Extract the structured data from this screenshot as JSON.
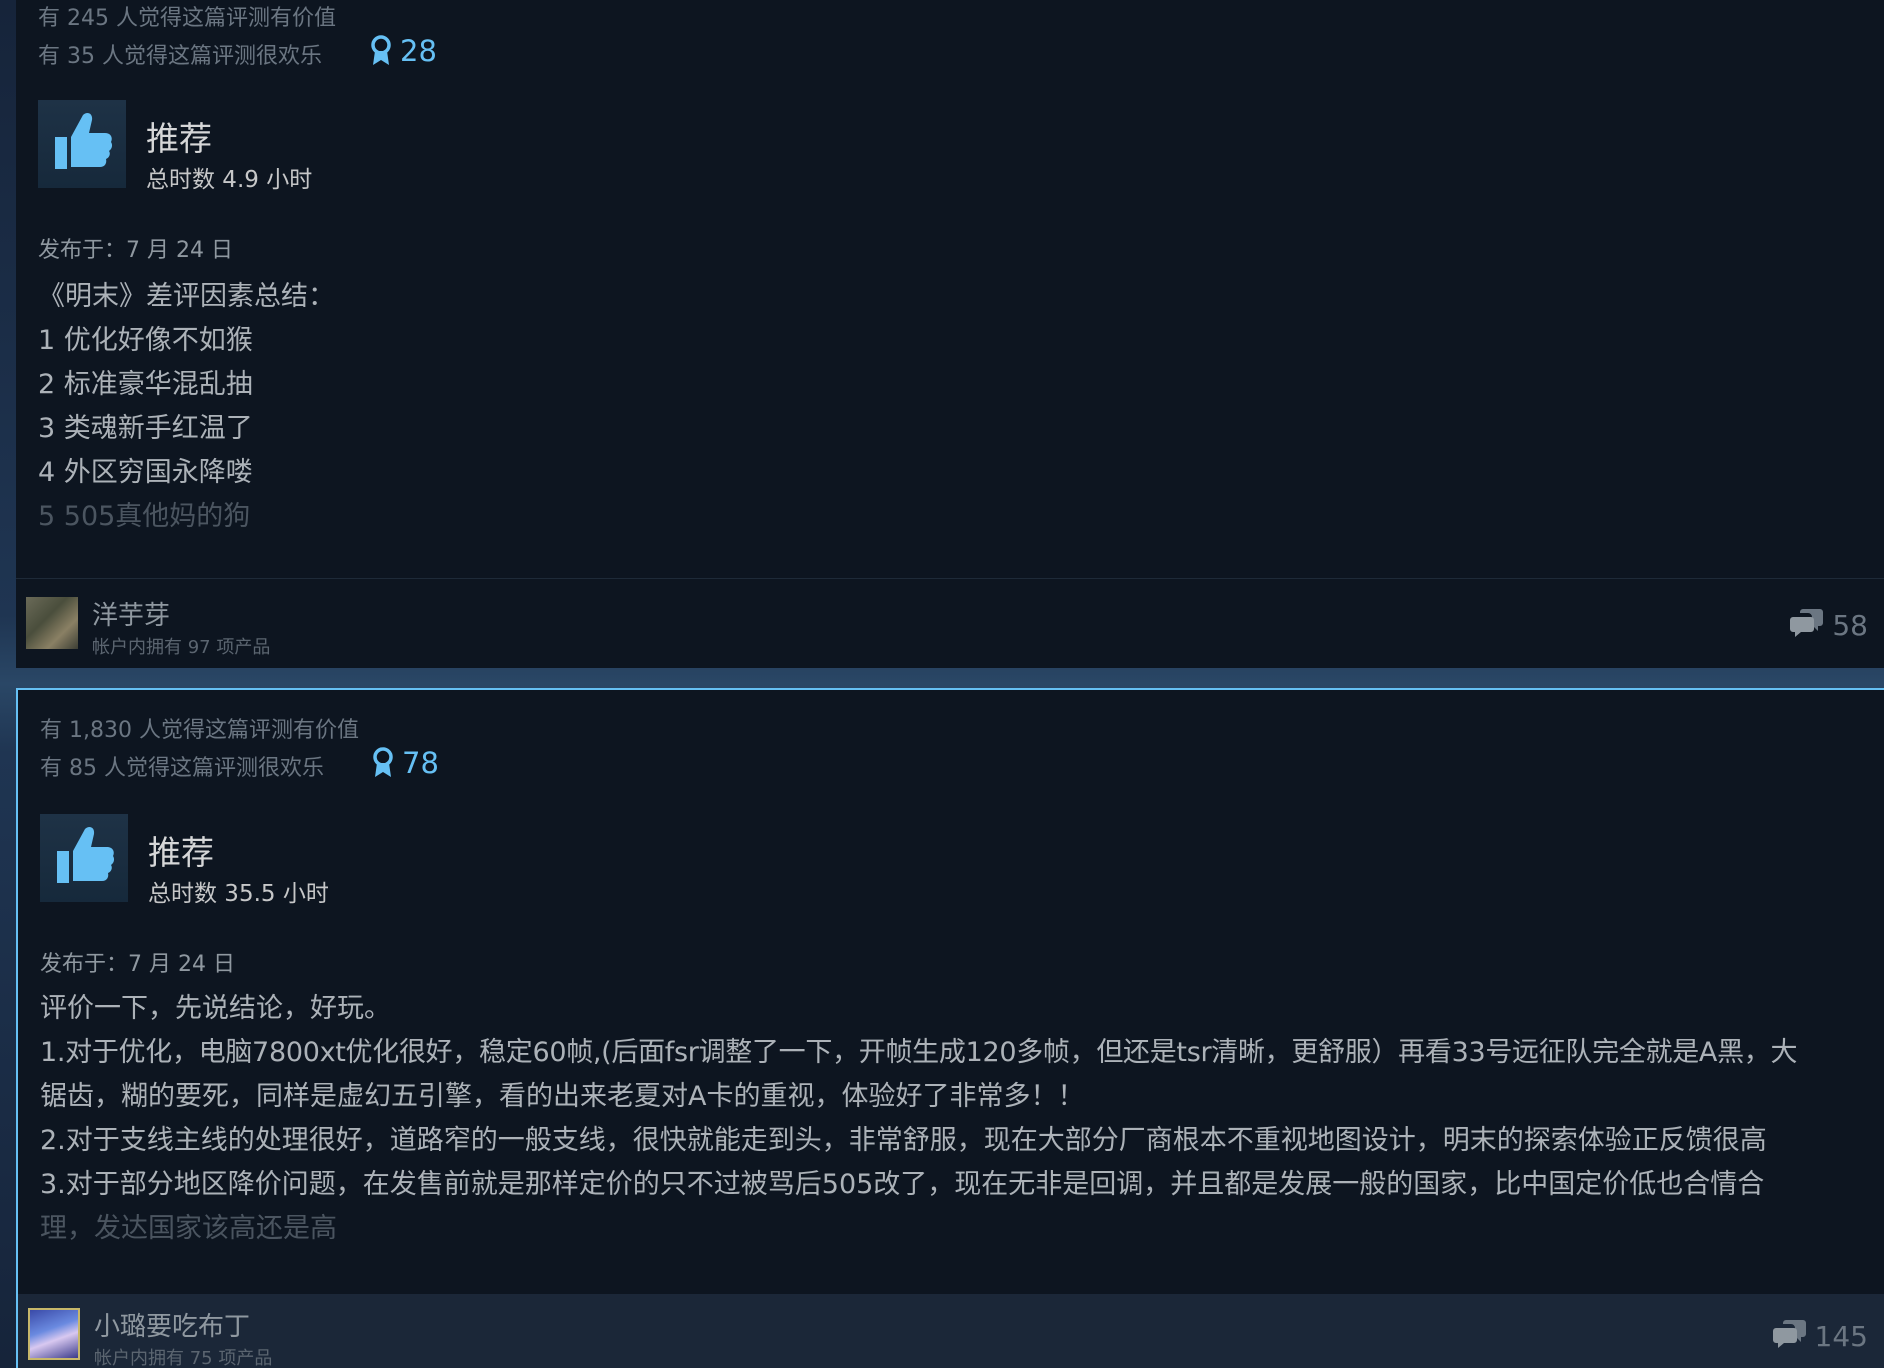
{
  "reviews": [
    {
      "helpful_text": "有 245 人觉得这篇评测有价值",
      "funny_text": "有 35 人觉得这篇评测很欢乐",
      "award_count": "28",
      "recommendation": "推荐",
      "hours": "总时数 4.9 小时",
      "posted": "发布于：7 月 24 日",
      "body": [
        "《明末》差评因素总结：",
        "1 优化好像不如猴",
        "2 标准豪华混乱抽",
        "3 类魂新手红温了",
        "4 外区穷国永降喽",
        "5 505真他妈的狗"
      ],
      "username": "洋芋芽",
      "products": "帐户内拥有 97 项产品",
      "comment_count": "58"
    },
    {
      "helpful_text": "有 1,830 人觉得这篇评测有价值",
      "funny_text": "有 85 人觉得这篇评测很欢乐",
      "award_count": "78",
      "recommendation": "推荐",
      "hours": "总时数 35.5 小时",
      "posted": "发布于：7 月 24 日",
      "body": [
        "评价一下，先说结论，好玩。",
        "1.对于优化，电脑7800xt优化很好，稳定60帧,(后面fsr调整了一下，开帧生成120多帧，但还是tsr清晰，更舒服）再看33号远征队完全就是A黑，大",
        "锯齿，糊的要死，同样是虚幻五引擎，看的出来老夏对A卡的重视，体验好了非常多！！",
        "2.对于支线主线的处理很好，道路窄的一般支线，很快就能走到头，非常舒服，现在大部分厂商根本不重视地图设计，明末的探索体验正反馈很高",
        "3.对于部分地区降价问题，在发售前就是那样定价的只不过被骂后505改了，现在无非是回调，并且都是发展一般的国家，比中国定价低也合情合",
        "理，发达国家该高还是高"
      ],
      "username": "小璐要吃布丁",
      "products": "帐户内拥有 75 项产品",
      "comment_count": "145"
    }
  ],
  "icons": {
    "award": "award-ribbon-icon",
    "thumb": "thumbs-up-icon",
    "comment": "comment-bubbles-icon"
  },
  "colors": {
    "accent": "#66c0f4",
    "card_bg": "#0d1520",
    "text": "#acb2b8"
  }
}
